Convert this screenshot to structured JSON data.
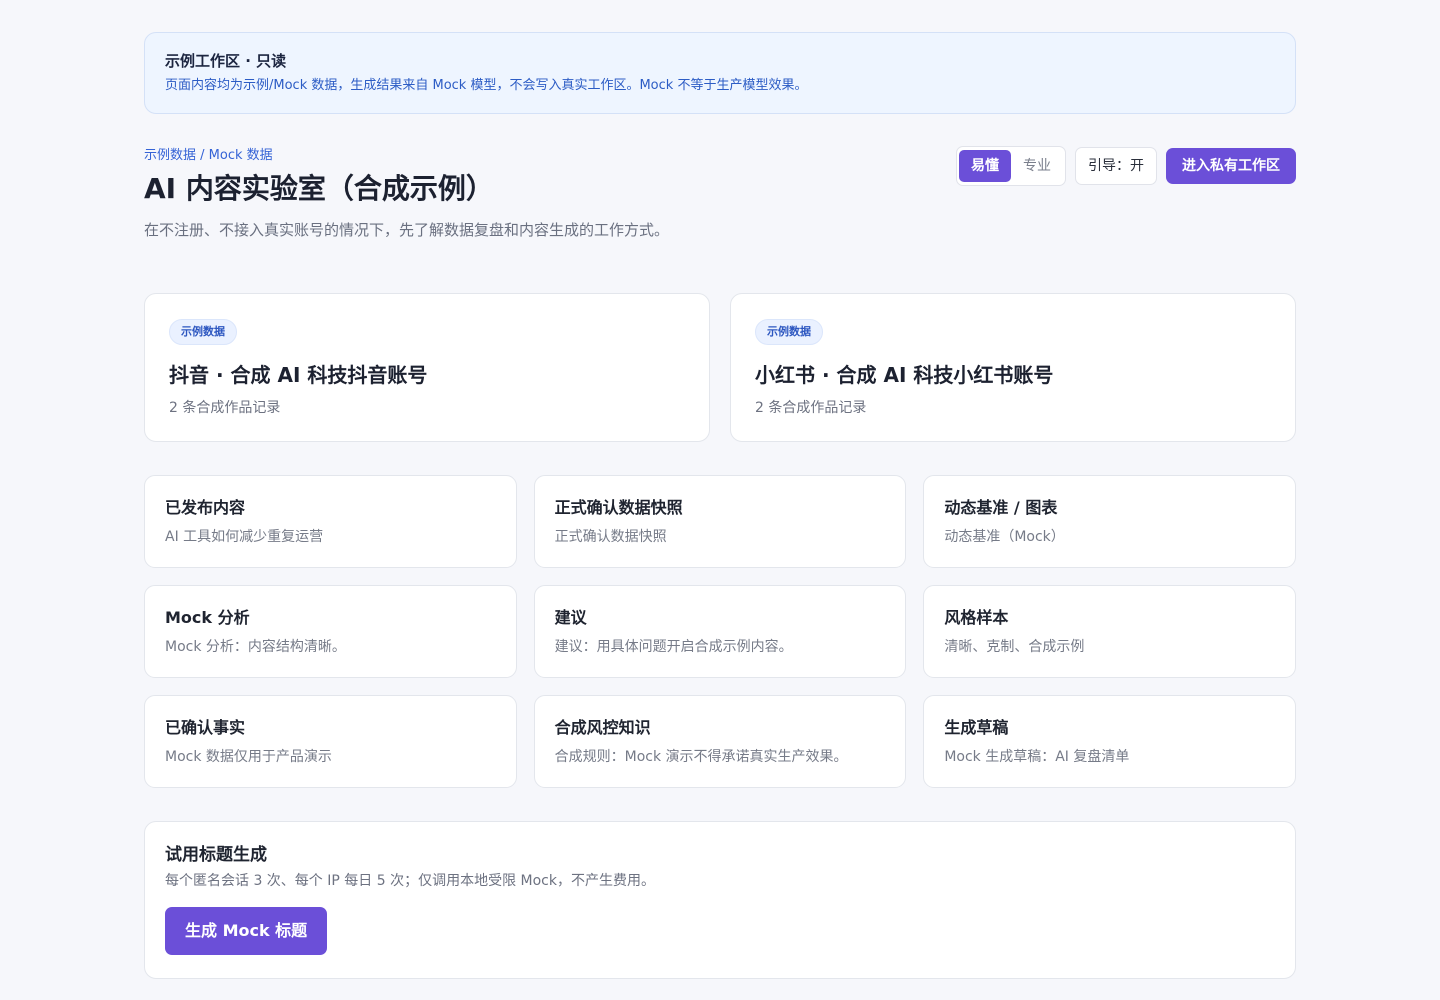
{
  "notice": {
    "title": "示例工作区 · 只读",
    "text": "页面内容均为示例/Mock 数据，生成结果来自 Mock 模型，不会写入真实工作区。Mock 不等于生产模型效果。"
  },
  "header": {
    "breadcrumb": "示例数据 / Mock 数据",
    "title": "AI 内容实验室（合成示例）",
    "subtitle": "在不注册、不接入真实账号的情况下，先了解数据复盘和内容生成的工作方式。",
    "mode_toggle": {
      "easy": "易懂",
      "pro": "专业",
      "selected": "易懂"
    },
    "guide_label": "引导：开",
    "private_workspace_label": "进入私有工作区"
  },
  "accounts": [
    {
      "badge": "示例数据",
      "title": "抖音 · 合成 AI 科技抖音账号",
      "sub": "2 条合成作品记录"
    },
    {
      "badge": "示例数据",
      "title": "小红书 · 合成 AI 科技小红书账号",
      "sub": "2 条合成作品记录"
    }
  ],
  "tiles": [
    {
      "title": "已发布内容",
      "sub": "AI 工具如何减少重复运营"
    },
    {
      "title": "正式确认数据快照",
      "sub": "正式确认数据快照"
    },
    {
      "title": "动态基准 / 图表",
      "sub": "动态基准（Mock）"
    },
    {
      "title": "Mock 分析",
      "sub": "Mock 分析：内容结构清晰。"
    },
    {
      "title": "建议",
      "sub": "建议：用具体问题开启合成示例内容。"
    },
    {
      "title": "风格样本",
      "sub": "清晰、克制、合成示例"
    },
    {
      "title": "已确认事实",
      "sub": "Mock 数据仅用于产品演示"
    },
    {
      "title": "合成风控知识",
      "sub": "合成规则：Mock 演示不得承诺真实生产效果。"
    },
    {
      "title": "生成草稿",
      "sub": "Mock 生成草稿：AI 复盘清单"
    }
  ],
  "generator": {
    "title": "试用标题生成",
    "sub": "每个匿名会话 3 次、每个 IP 每日 5 次；仅调用本地受限 Mock，不产生费用。",
    "button": "生成 Mock 标题"
  },
  "colors": {
    "accent": "#6b4fd8",
    "notice_bg": "#eef5ff",
    "link_blue": "#3563d6",
    "page_bg": "#f6f7fb"
  }
}
